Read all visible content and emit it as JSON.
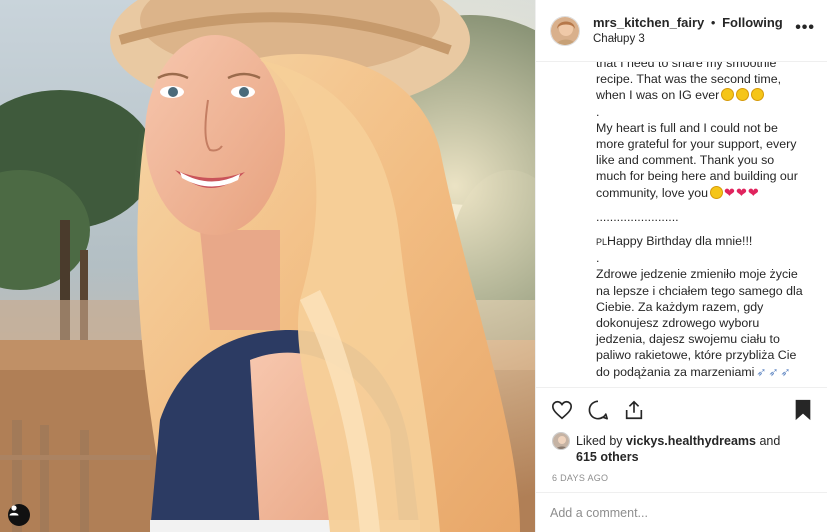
{
  "post": {
    "username": "mrs_kitchen_fairy",
    "separator": "•",
    "follow_status": "Following",
    "location": "Chałupy 3",
    "more_icon": "ellipsis-icon"
  },
  "caption": {
    "lines": [
      "that I need to share my smoothie",
      "recipe. That was the second time,",
      "when I was on IG ever",
      ".",
      "My heart is full and I could not be",
      "more grateful for your support, every",
      "like and comment. Thank you so",
      "much for being here and building our",
      "community, love you",
      "........................",
      "Happy Birthday dla mnie!!!",
      ".",
      "Zdrowe jedzenie zmieniło moje życie",
      "na lepsze i chciałem tego samego dla",
      "Ciebie. Za każdym razem, gdy",
      "dokonujesz zdrowego wyboru",
      "jedzenia, dajesz swojemu ciału to",
      "paliwo rakietowe, które przybliża Cie",
      "do podążania za marzeniami",
      "."
    ],
    "pl_prefix": "PL",
    "emoji": {
      "smile": "😅",
      "heart": "❤",
      "rocket": "🚀"
    }
  },
  "likes": {
    "prefix": "Liked by",
    "user": "vickys.healthydreams",
    "conjunction": "and",
    "others": "615 others"
  },
  "time_ago": "6 DAYS AGO",
  "comment": {
    "placeholder": "Add a comment..."
  },
  "colors": {
    "text": "#262626",
    "muted": "#8e8e8e",
    "border": "#efefef",
    "heart": "#e0245e"
  }
}
